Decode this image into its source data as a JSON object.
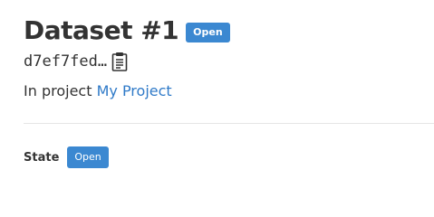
{
  "header": {
    "title": "Dataset #1",
    "status_badge": "Open"
  },
  "identifier": {
    "short_id": "d7ef7fed…",
    "copy_icon": "clipboard-icon"
  },
  "project": {
    "prefix": "In project",
    "link_text": "My Project"
  },
  "details": {
    "state_label": "State",
    "state_value": "Open"
  },
  "colors": {
    "accent": "#3b88d1",
    "link": "#2f7ac8",
    "text": "#333333",
    "divider": "#e6e6e6"
  }
}
